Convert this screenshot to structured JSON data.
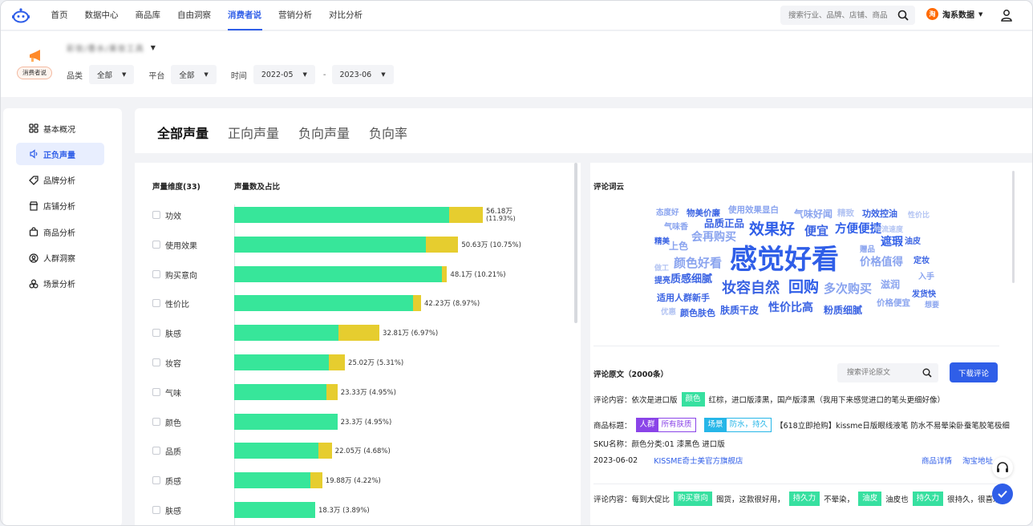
{
  "nav": {
    "items": [
      "首页",
      "数据中心",
      "商品库",
      "自由洞察",
      "消费者说",
      "营销分析",
      "对比分析"
    ],
    "active_index": 4,
    "search_placeholder": "搜索行业、品牌、店铺、商品",
    "brand_logo": "淘",
    "brand_name": "淘系数据"
  },
  "header": {
    "badge_label": "消费者说",
    "crumb_blurred": "彩妆/香水/美妆工具",
    "filters": {
      "category_label": "品类",
      "category_value": "全部",
      "platform_label": "平台",
      "platform_value": "全部",
      "time_label": "时间",
      "time_start": "2022-05",
      "time_sep": "-",
      "time_end": "2023-06"
    }
  },
  "sidebar": {
    "items": [
      {
        "label": "基本概况",
        "icon": "grid-icon"
      },
      {
        "label": "正负声量",
        "icon": "sound-icon"
      },
      {
        "label": "品牌分析",
        "icon": "tag-icon"
      },
      {
        "label": "店铺分析",
        "icon": "shop-icon"
      },
      {
        "label": "商品分析",
        "icon": "bag-icon"
      },
      {
        "label": "人群洞察",
        "icon": "person-icon"
      },
      {
        "label": "场景分析",
        "icon": "scene-icon"
      }
    ],
    "active_index": 1
  },
  "tabs": [
    "全部声量",
    "正向声量",
    "负向声量",
    "负向率"
  ],
  "chart": {
    "dim_header": "声量维度(33)",
    "val_header": "声量数及占比"
  },
  "chart_data": {
    "type": "bar",
    "orientation": "horizontal",
    "stacked": true,
    "categories": [
      "功效",
      "使用效果",
      "购买意向",
      "性价比",
      "肤感",
      "妆容",
      "气味",
      "颜色",
      "品质",
      "质感",
      "肤感"
    ],
    "series": [
      {
        "color": "#37e69a",
        "values": [
          48.5,
          43.4,
          47.0,
          40.4,
          23.6,
          21.3,
          20.8,
          23.3,
          19.0,
          17.2,
          18.3
        ]
      },
      {
        "color": "#e6cd2f",
        "values": [
          7.68,
          7.23,
          1.1,
          1.83,
          9.21,
          3.72,
          2.53,
          0,
          3.05,
          2.68,
          0
        ]
      }
    ],
    "totals": [
      56.18,
      50.63,
      48.1,
      42.23,
      32.81,
      25.02,
      23.33,
      23.3,
      22.05,
      19.88,
      18.3
    ],
    "labels": [
      "56.18万",
      "50.63万 (10.75%)",
      "48.1万 (10.21%)",
      "42.23万 (8.97%)",
      "32.81万 (6.97%)",
      "25.02万 (5.31%)",
      "23.33万 (4.95%)",
      "23.3万 (4.95%)",
      "22.05万 (4.68%)",
      "19.88万 (4.22%)",
      "18.3万 (3.89%)"
    ],
    "first_pct": "(11.93%)",
    "xlim": [
      0,
      65
    ]
  },
  "cloud": {
    "title": "评论词云",
    "words": [
      {
        "t": "态度好",
        "c": "#8aa4ef"
      },
      {
        "t": "物美价廉",
        "c": "#3a63e3"
      },
      {
        "t": "使用效果显白",
        "c": "#8aa4ef"
      },
      {
        "t": "气味好闻",
        "c": "#8aa4ef"
      },
      {
        "t": "精致",
        "c": "#b3c4f3"
      },
      {
        "t": "功效控油",
        "c": "#3a63e3"
      },
      {
        "t": "性价比",
        "c": "#b3c4f3"
      },
      {
        "t": "气味香",
        "c": "#8aa4ef"
      },
      {
        "t": "品质正品",
        "c": "#3a63e3"
      },
      {
        "t": "效果好",
        "c": "#2f5ee8"
      },
      {
        "t": "便宜",
        "c": "#3a63e3"
      },
      {
        "t": "方便便捷",
        "c": "#2f5ee8"
      },
      {
        "t": "物流速度",
        "c": "#b3c4f3"
      },
      {
        "t": "精美",
        "c": "#3a63e3"
      },
      {
        "t": "上色",
        "c": "#8aa4ef"
      },
      {
        "t": "会再购买",
        "c": "#8aa4ef"
      },
      {
        "t": "遮瑕",
        "c": "#2f5ee8"
      },
      {
        "t": "油皮",
        "c": "#3a63e3"
      },
      {
        "t": "赠品",
        "c": "#8aa4ef"
      },
      {
        "t": "做工",
        "c": "#b3c4f3"
      },
      {
        "t": "颜色好看",
        "c": "#8aa4ef"
      },
      {
        "t": "感觉好看",
        "c": "#2f5ee8"
      },
      {
        "t": "价格值得",
        "c": "#8aa4ef"
      },
      {
        "t": "定妆",
        "c": "#3a63e3"
      },
      {
        "t": "提亮",
        "c": "#3a63e3"
      },
      {
        "t": "质感细腻",
        "c": "#3a63e3"
      },
      {
        "t": "入手",
        "c": "#8aa4ef"
      },
      {
        "t": "妆容自然",
        "c": "#3a63e3"
      },
      {
        "t": "回购",
        "c": "#2f5ee8"
      },
      {
        "t": "多次购买",
        "c": "#8aa4ef"
      },
      {
        "t": "滋润",
        "c": "#8aa4ef"
      },
      {
        "t": "发货快",
        "c": "#3a63e3"
      },
      {
        "t": "适用人群新手",
        "c": "#3a63e3"
      },
      {
        "t": "价格便宜",
        "c": "#8aa4ef"
      },
      {
        "t": "想要",
        "c": "#8aa4ef"
      },
      {
        "t": "优惠",
        "c": "#b3c4f3"
      },
      {
        "t": "颜色肤色",
        "c": "#3a63e3"
      },
      {
        "t": "肤质干皮",
        "c": "#3a63e3"
      },
      {
        "t": "性价比高",
        "c": "#3a63e3"
      },
      {
        "t": "粉质细腻",
        "c": "#3a63e3"
      }
    ]
  },
  "comments": {
    "title": "评论原文（2000条）",
    "search_placeholder": "搜索评论原文",
    "download_label": "下载评论",
    "c1": {
      "content_label": "评论内容：",
      "content_pre": "依次是进口版",
      "content_tag": "颜色",
      "content_post": "红棕，进口版漆黑，国产版漆黑（我用下来感觉进口的笔头更细好像）",
      "title_label": "商品标题：",
      "tag1_key": "人群",
      "tag1_val": "所有肤质",
      "tag2_key": "场景",
      "tag2_val": "防水，持久",
      "title_text": "【618立即抢购】kissme日版眼线液笔 防水不易晕染卧蚕笔胶笔极细",
      "sku_label": "SKU名称：",
      "sku_text": "颜色分类:01 漆黑色 进口版",
      "date": "2023-06-02",
      "shop": "KISSME奇士美官方旗舰店",
      "link1": "商品详情",
      "link2": "淘宝地址"
    },
    "c2": {
      "content_label": "评论内容：",
      "p1": "每到大促比",
      "t1": "购买意向",
      "p2": "囤货，这款很好用，",
      "t2": "持久力",
      "p3": "不晕染，",
      "t3": "油皮",
      "p4": "油皮也",
      "t4": "持久力",
      "p5": "很持久，很喜欢"
    }
  }
}
